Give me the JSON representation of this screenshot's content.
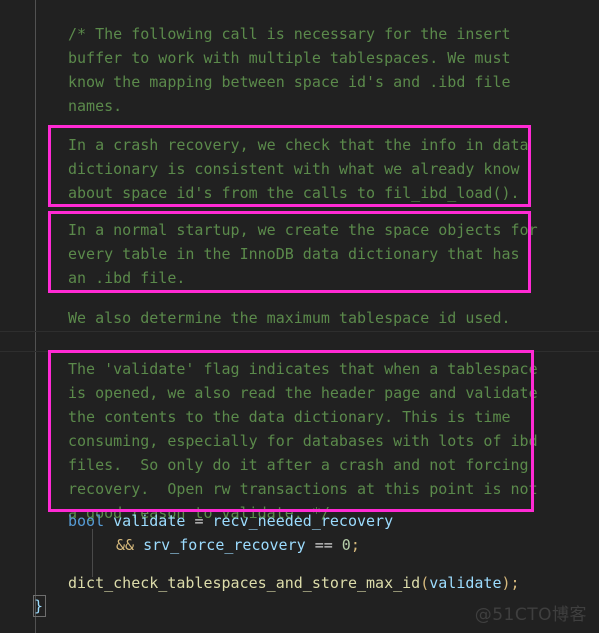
{
  "editor": {
    "background": "#212121",
    "comment_color": "#5b8a4b",
    "keyword_color": "#569cd6",
    "identifier_color": "#9cdcfe",
    "function_color": "#dcdcaa",
    "punctuation_color": "#d7ba7d",
    "highlight_border_color": "#ff2ad4"
  },
  "comment_block_1": {
    "lines": [
      "/* The following call is necessary for the insert",
      "buffer to work with multiple tablespaces. We must",
      "know the mapping between space id's and .ibd file",
      "names."
    ]
  },
  "highlight_1": {
    "lines": [
      "In a crash recovery, we check that the info in data",
      "dictionary is consistent with what we already know",
      "about space id's from the calls to fil_ibd_load()."
    ]
  },
  "highlight_2": {
    "lines": [
      "In a normal startup, we create the space objects for",
      "every table in the InnoDB data dictionary that has",
      "an .ibd file."
    ]
  },
  "comment_block_2": {
    "lines": [
      "We also determine the maximum tablespace id used."
    ]
  },
  "highlight_3": {
    "lines": [
      "The 'validate' flag indicates that when a tablespace",
      "is opened, we also read the header page and validate",
      "the contents to the data dictionary. This is time",
      "consuming, especially for databases with lots of ibd",
      "files.  So only do it after a crash and not forcing",
      "recovery.  Open rw transactions at this point is not",
      "a good reason to validate. */"
    ]
  },
  "code": {
    "line_bool_keyword": "bool",
    "line_bool_var": " validate ",
    "line_bool_eq": "= ",
    "line_bool_rhs": "recv_needed_recovery",
    "line_and_op": "&&",
    "line_and_var": " srv_force_recovery ",
    "line_and_eq": "== ",
    "line_and_num": "0",
    "line_and_semi": ";",
    "call_fn": "dict_check_tablespaces_and_store_max_id",
    "call_open": "(",
    "call_arg": "validate",
    "call_close": ")",
    "call_semi": ";",
    "closing_brace": "}"
  },
  "watermark": {
    "text": "@51CTO博客"
  }
}
